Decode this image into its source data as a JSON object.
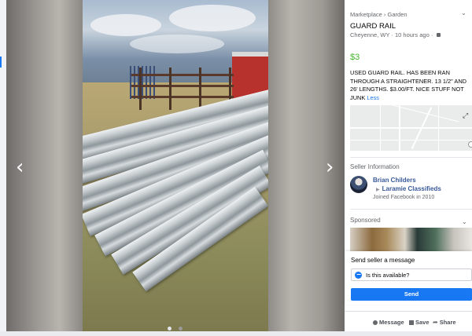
{
  "listing": {
    "breadcrumb": "Marketplace › Garden",
    "title": "GUARD RAIL",
    "location": "Cheyenne, WY · 10 hours ago ·",
    "price": "$3",
    "description": "USED GUARD RAIL. HAS BEEN RAN THROUGH A STRAIGHTENER. 13 1/2\" AND 26' LENGTHS. $3.00/FT. NICE STUFF NOT JUNK ",
    "less_link": "Less"
  },
  "seller": {
    "heading": "Seller Information",
    "name": "Brian Childers",
    "group": "Laramie Classifieds",
    "joined": "Joined Facebook in 2010"
  },
  "sponsored": {
    "heading": "Sponsored"
  },
  "message": {
    "heading": "Send seller a message",
    "input_value": "Is this available?",
    "send_label": "Send"
  },
  "actions": {
    "message_label": "Message",
    "save_label": "Save",
    "share_label": "Share"
  },
  "viewer": {
    "photo_count": 2,
    "active_index": 0,
    "prev_icon": "chevron-left-icon",
    "next_icon": "chevron-right-icon"
  },
  "colors": {
    "price": "#42b72a",
    "link": "#385898",
    "button": "#1877f2"
  }
}
